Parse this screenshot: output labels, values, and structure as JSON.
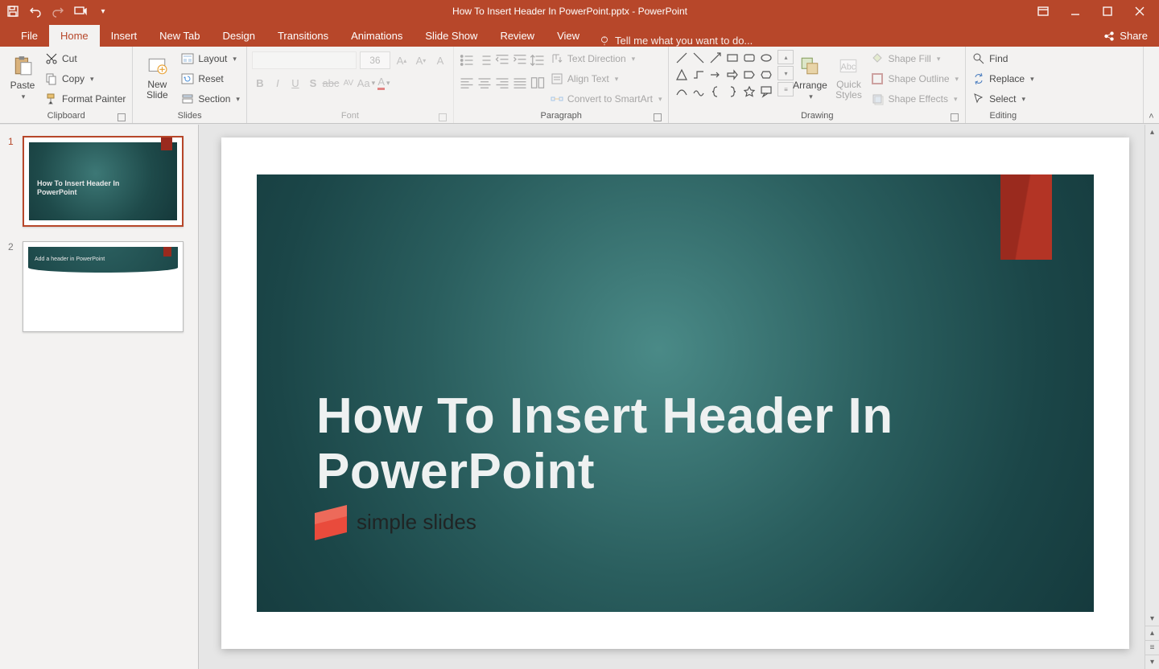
{
  "titlebar": {
    "title": "How To Insert Header In PowerPoint.pptx - PowerPoint"
  },
  "tabs": {
    "file": "File",
    "home": "Home",
    "insert": "Insert",
    "newtab": "New Tab",
    "design": "Design",
    "transitions": "Transitions",
    "animations": "Animations",
    "slideshow": "Slide Show",
    "review": "Review",
    "view": "View",
    "tellme": "Tell me what you want to do...",
    "share": "Share"
  },
  "ribbon": {
    "clipboard": {
      "paste": "Paste",
      "cut": "Cut",
      "copy": "Copy",
      "formatpainter": "Format Painter",
      "label": "Clipboard"
    },
    "slides": {
      "newslide": "New\nSlide",
      "layout": "Layout",
      "reset": "Reset",
      "section": "Section",
      "label": "Slides"
    },
    "font": {
      "size": "36",
      "label": "Font"
    },
    "paragraph": {
      "textdir": "Text Direction",
      "align": "Align Text",
      "smartart": "Convert to SmartArt",
      "label": "Paragraph"
    },
    "drawing": {
      "arrange": "Arrange",
      "quickstyles": "Quick\nStyles",
      "shapefill": "Shape Fill",
      "shapeoutline": "Shape Outline",
      "shapeeffects": "Shape Effects",
      "label": "Drawing"
    },
    "editing": {
      "find": "Find",
      "replace": "Replace",
      "select": "Select",
      "label": "Editing"
    }
  },
  "slides": {
    "s1": {
      "num": "1",
      "title": "How To Insert Header In PowerPoint"
    },
    "s2": {
      "num": "2",
      "title": "Add a header in PowerPoint"
    }
  },
  "main": {
    "title": "How To Insert Header In PowerPoint",
    "logo": "simple slides"
  }
}
